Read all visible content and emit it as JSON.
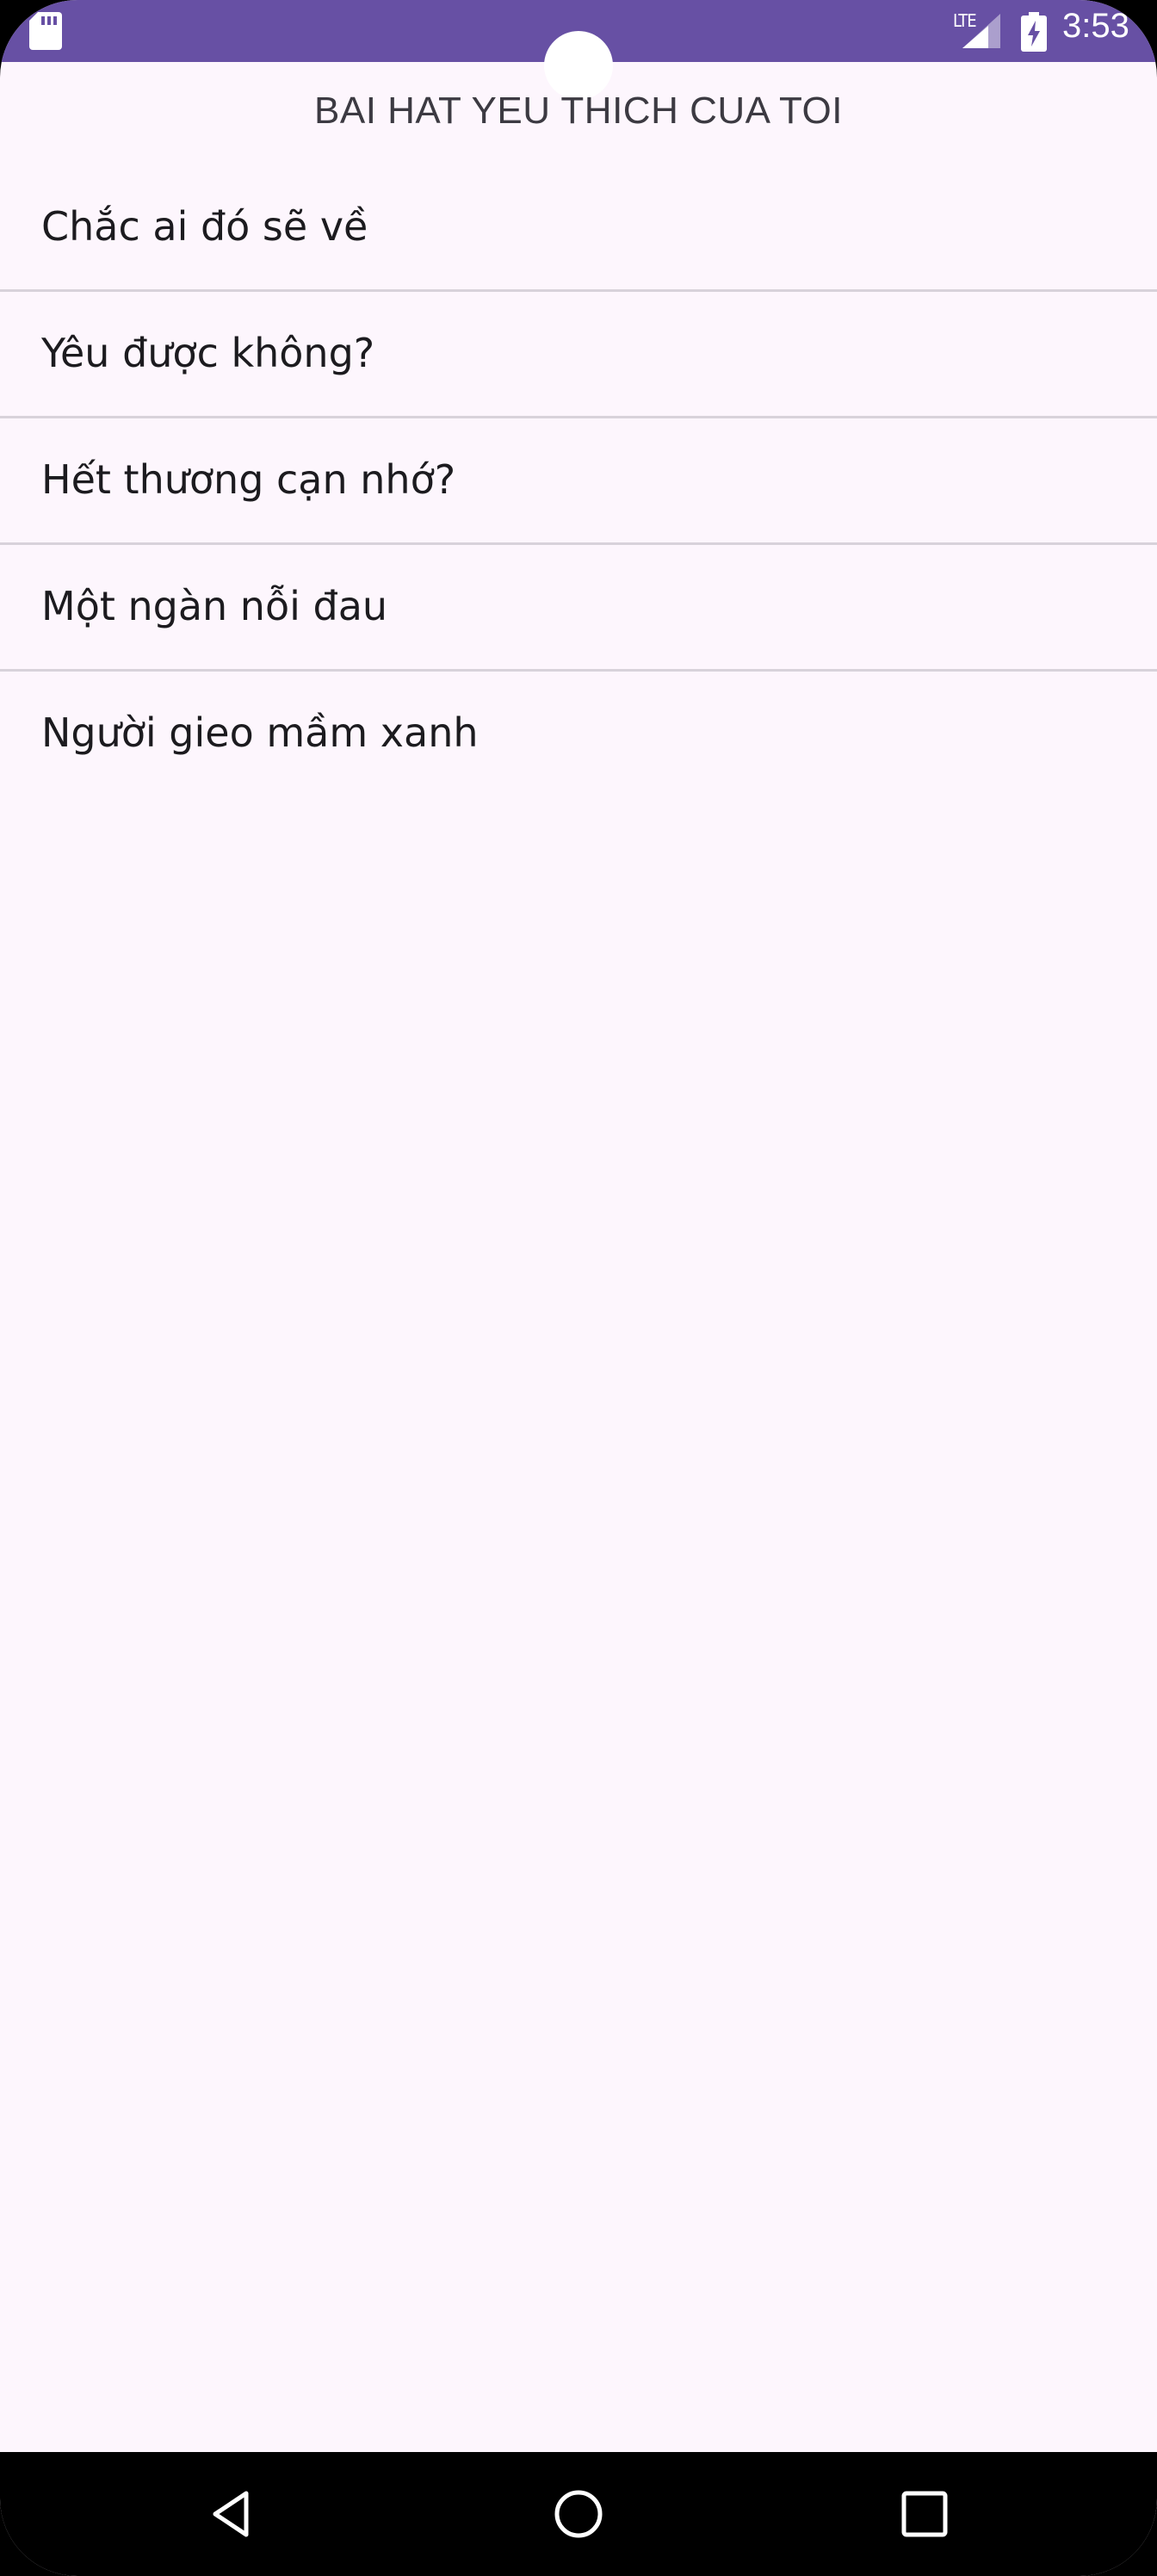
{
  "status_bar": {
    "time": "3:53",
    "network": "LTE",
    "icons": [
      "sd-card-icon",
      "signal-icon",
      "battery-charging-icon"
    ],
    "color": "#6750a4"
  },
  "header": {
    "title": "BAI HAT YEU THICH CUA TOI"
  },
  "songs": [
    {
      "title": "Chắc ai đó sẽ về"
    },
    {
      "title": "Yêu được không?"
    },
    {
      "title": "Hết thương cạn nhớ?"
    },
    {
      "title": "Một ngàn nỗi đau"
    },
    {
      "title": "Người gieo mầm xanh"
    }
  ],
  "nav_bar": {
    "icons": [
      "back-icon",
      "home-icon",
      "recents-icon"
    ]
  },
  "colors": {
    "background": "#fdf6fd",
    "accent": "#6750a4",
    "divider": "#d8d2da"
  }
}
